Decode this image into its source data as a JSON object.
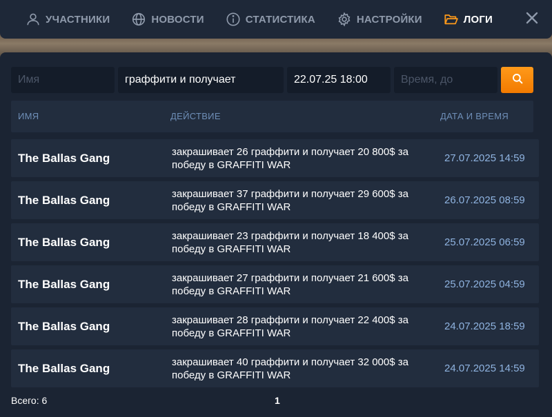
{
  "nav": {
    "items": [
      {
        "label": "УЧАСТНИКИ",
        "icon": "user-icon",
        "active": false
      },
      {
        "label": "НОВОСТИ",
        "icon": "globe-icon",
        "active": false
      },
      {
        "label": "СТАТИСТИКА",
        "icon": "info-icon",
        "active": false
      },
      {
        "label": "НАСТРОЙКИ",
        "icon": "gear-icon",
        "active": false
      },
      {
        "label": "ЛОГИ",
        "icon": "folder-open-icon",
        "active": true
      }
    ],
    "close_icon": "close-icon",
    "accent_color": "#ff9a1a"
  },
  "filters": {
    "name_placeholder": "Имя",
    "name_value": "",
    "action_value": "граффити и получает",
    "from_value": "22.07.25 18:00",
    "to_placeholder": "Время, до",
    "to_value": "",
    "search_icon": "search-icon"
  },
  "table": {
    "columns": [
      "ИМЯ",
      "ДЕЙСТВИЕ",
      "ДАТА И ВРЕМЯ"
    ],
    "rows": [
      {
        "name": "The Ballas Gang",
        "action": "закрашивает 26 граффити и получает 20 800$ за победу в GRAFFITI WAR",
        "date": "27.07.2025 14:59"
      },
      {
        "name": "The Ballas Gang",
        "action": "закрашивает 37 граффити и получает 29 600$ за победу в GRAFFITI WAR",
        "date": "26.07.2025 08:59"
      },
      {
        "name": "The Ballas Gang",
        "action": "закрашивает 23 граффити и получает 18 400$ за победу в GRAFFITI WAR",
        "date": "25.07.2025 06:59"
      },
      {
        "name": "The Ballas Gang",
        "action": "закрашивает 27 граффити и получает 21 600$ за победу в GRAFFITI WAR",
        "date": "25.07.2025 04:59"
      },
      {
        "name": "The Ballas Gang",
        "action": "закрашивает 28 граффити и получает 22 400$ за победу в GRAFFITI WAR",
        "date": "24.07.2025 18:59"
      },
      {
        "name": "The Ballas Gang",
        "action": "закрашивает 40 граффити и получает 32 000$ за победу в GRAFFITI WAR",
        "date": "24.07.2025 14:59"
      }
    ]
  },
  "footer": {
    "total": "Всего: 6",
    "page": "1"
  }
}
